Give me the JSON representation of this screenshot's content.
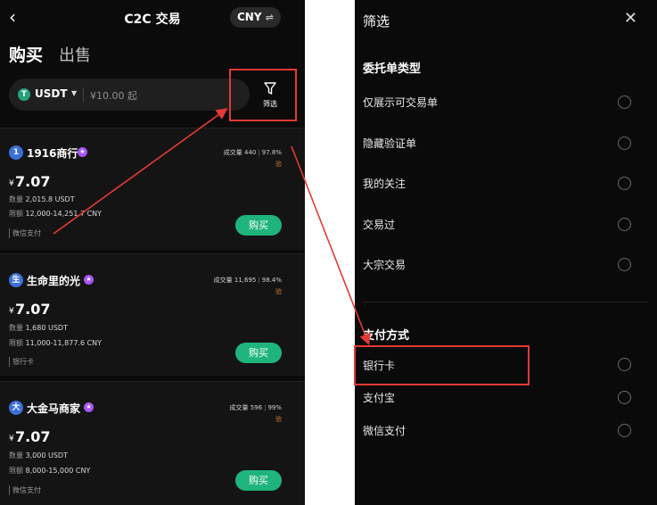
{
  "left": {
    "header": {
      "back_icon": "‹",
      "title": "C2C 交易",
      "currency": "CNY",
      "currency_swap_icon": "⇌"
    },
    "tabs": {
      "buy": "购买",
      "sell": "出售"
    },
    "search": {
      "coin_icon_letter": "T",
      "coin": "USDT",
      "caret": "▼",
      "amount_placeholder": "¥10.00 起"
    },
    "filter": {
      "label": "筛选"
    },
    "ads": [
      {
        "avatar": "1",
        "merchant": "1916商行",
        "badge": "★",
        "stats": [
          "成交量 440",
          "97.8%"
        ],
        "verified": "验",
        "currency": "¥",
        "price": "7.07",
        "quantity_label": "数量",
        "quantity": "2,015.8 USDT",
        "limit_label": "限额",
        "limit": "12,000-14,251.7 CNY",
        "payment": "微信支付",
        "buy_label": "购买"
      },
      {
        "avatar": "生",
        "merchant": "生命里的光",
        "badge": "★",
        "stats": [
          "成交量 11,695",
          "98.4%"
        ],
        "verified": "验",
        "currency": "¥",
        "price": "7.07",
        "quantity_label": "数量",
        "quantity": "1,680 USDT",
        "limit_label": "限额",
        "limit": "11,000-11,877.6 CNY",
        "payment": "银行卡",
        "buy_label": "购买"
      },
      {
        "avatar": "大",
        "merchant": "大金马商家",
        "badge": "★",
        "stats": [
          "成交量 596",
          "99%"
        ],
        "verified": "验",
        "currency": "¥",
        "price": "7.07",
        "quantity_label": "数量",
        "quantity": "3,000 USDT",
        "limit_label": "限额",
        "limit": "8,000-15,000 CNY",
        "payment": "微信支付",
        "buy_label": "购买"
      }
    ]
  },
  "right": {
    "title": "筛选",
    "close_icon": "✕",
    "order_type_section": "委托单类型",
    "order_types": [
      "仅展示可交易单",
      "隐藏验证单",
      "我的关注",
      "交易过",
      "大宗交易"
    ],
    "payment_section": "支付方式",
    "payment_methods": [
      "银行卡",
      "支付宝",
      "微信支付"
    ]
  },
  "colors": {
    "accent_green": "#1fb47d",
    "highlight_red": "#e53935",
    "badge_purple": "#a855f7",
    "usdt_green": "#26a17b"
  }
}
